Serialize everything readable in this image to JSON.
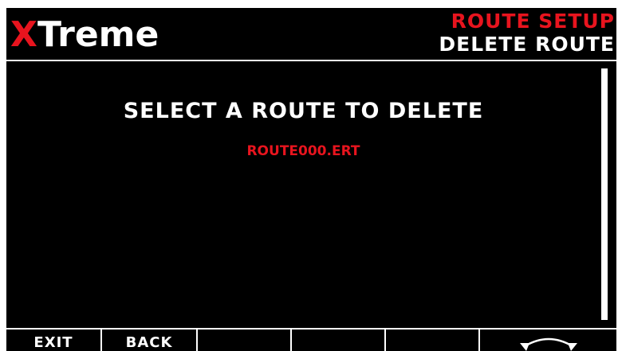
{
  "header": {
    "logo_x": "X",
    "logo_rest": "Treme",
    "title_top": "ROUTE SETUP",
    "title_bottom": "DELETE ROUTE"
  },
  "main": {
    "prompt": "SELECT A ROUTE TO DELETE",
    "routes": [
      {
        "label": "ROUTE000.ERT",
        "selected": true
      }
    ]
  },
  "softkeys": [
    {
      "label": "EXIT"
    },
    {
      "label": "BACK"
    },
    {
      "label": ""
    },
    {
      "label": ""
    },
    {
      "label": ""
    },
    {
      "label": "",
      "icon": "rotary-knob-icon"
    }
  ],
  "colors": {
    "background": "#000000",
    "accent_red": "#e8141e",
    "text": "#ffffff"
  }
}
